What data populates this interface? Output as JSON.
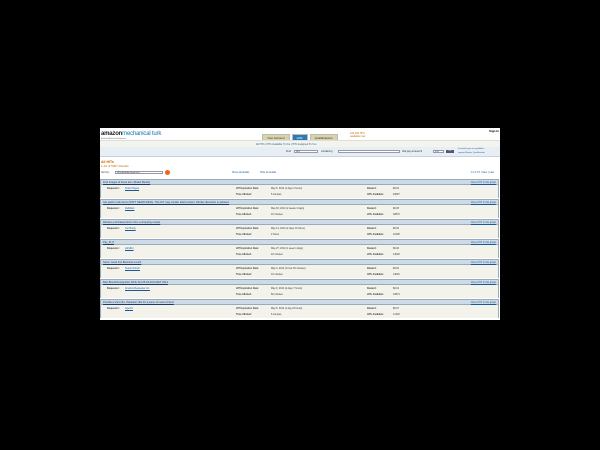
{
  "header": {
    "signin": "Sign In",
    "logo_main": "amazon",
    "logo_accent": "mechanical turk",
    "logo_sub": "Artificial Artificial Intelligence",
    "tabs": [
      "Your Account",
      "HITs",
      "Qualifications"
    ],
    "requester_link": "444,494 HITs available now"
  },
  "subnav": {
    "links": "All HITs  |  HITs Available To You  |  HITs Assigned To You"
  },
  "search": {
    "find_label": "Find",
    "find_value": "HITs",
    "containing_label": "containing",
    "containing_value": "",
    "reward_label": "that pay at least $",
    "reward_value": "0.00",
    "go": "GO",
    "option1": "for which you are qualified",
    "option2": "require Master Qualification"
  },
  "results": {
    "count": "All HITs",
    "summary": "1-10 of 5007 Results",
    "sort_label": "Sort by:",
    "sort_value": "HITs Available (most first)",
    "show_all": "Show all details",
    "hide_all": "Hide all details",
    "pager": "1 2 3 4 5  |  Next  |  Last"
  },
  "labels": {
    "requester": "Requester:",
    "expiration": "HIT Expiration Date:",
    "time_allotted": "Time Allotted:",
    "reward": "Reward:",
    "available": "HITs Available:",
    "view": "View a HIT in this group"
  },
  "hits": [
    {
      "title": "Find Images of these item (Radio Bands)",
      "requester": "Kristin Hayes",
      "expires": "May 5, 2014  (1 days 2 hours)",
      "time": "5 minutes",
      "reward": "$0.02",
      "available": "49697"
    },
    {
      "title": "Get paid to rate items (SOFT SEARCHING). This HIT may contain adult content. Worker discretion is advised.",
      "requester": "RelMaint",
      "expires": "May 18, 2014  (2 weeks 3 days)",
      "time": "10 minutes",
      "reward": "$0.05",
      "available": "18870"
    },
    {
      "title": "Retrieve purchased items from a shopping receipt",
      "requester": "Jon Brelig",
      "expires": "May 14, 2014  (2 days 10 hours)",
      "time": "2 hours",
      "reward": "$0.00",
      "available": "10195"
    },
    {
      "title": "Pay_M_8",
      "requester": "pollyflint",
      "expires": "May 27, 2014  (1 week 4 days)",
      "time": "40 minutes",
      "reward": "$0.00",
      "available": "14000"
    },
    {
      "title": "Store: Good Fun Business Lunch",
      "requester": "Susan Dorsch",
      "expires": "May 4, 2014  (1 hour 29 minutes)",
      "time": "10 minutes",
      "reward": "$0.52",
      "available": "14040"
    },
    {
      "title": "Best Brand Recognition Work Set 05-03-2014 RET 2014",
      "requester": "Amazon Requester Inc.",
      "expires": "May 9, 2014  (4 days 7 hours)",
      "time": "60 minutes",
      "reward": "$0.01",
      "available": "10874"
    },
    {
      "title": "Provide a short (8+ character) title for a piece of news content",
      "requester": "Agentic",
      "expires": "May 5, 2014  (1 day 22 hours)",
      "time": "6 minutes",
      "reward": "$0.07",
      "available": "17220"
    }
  ]
}
